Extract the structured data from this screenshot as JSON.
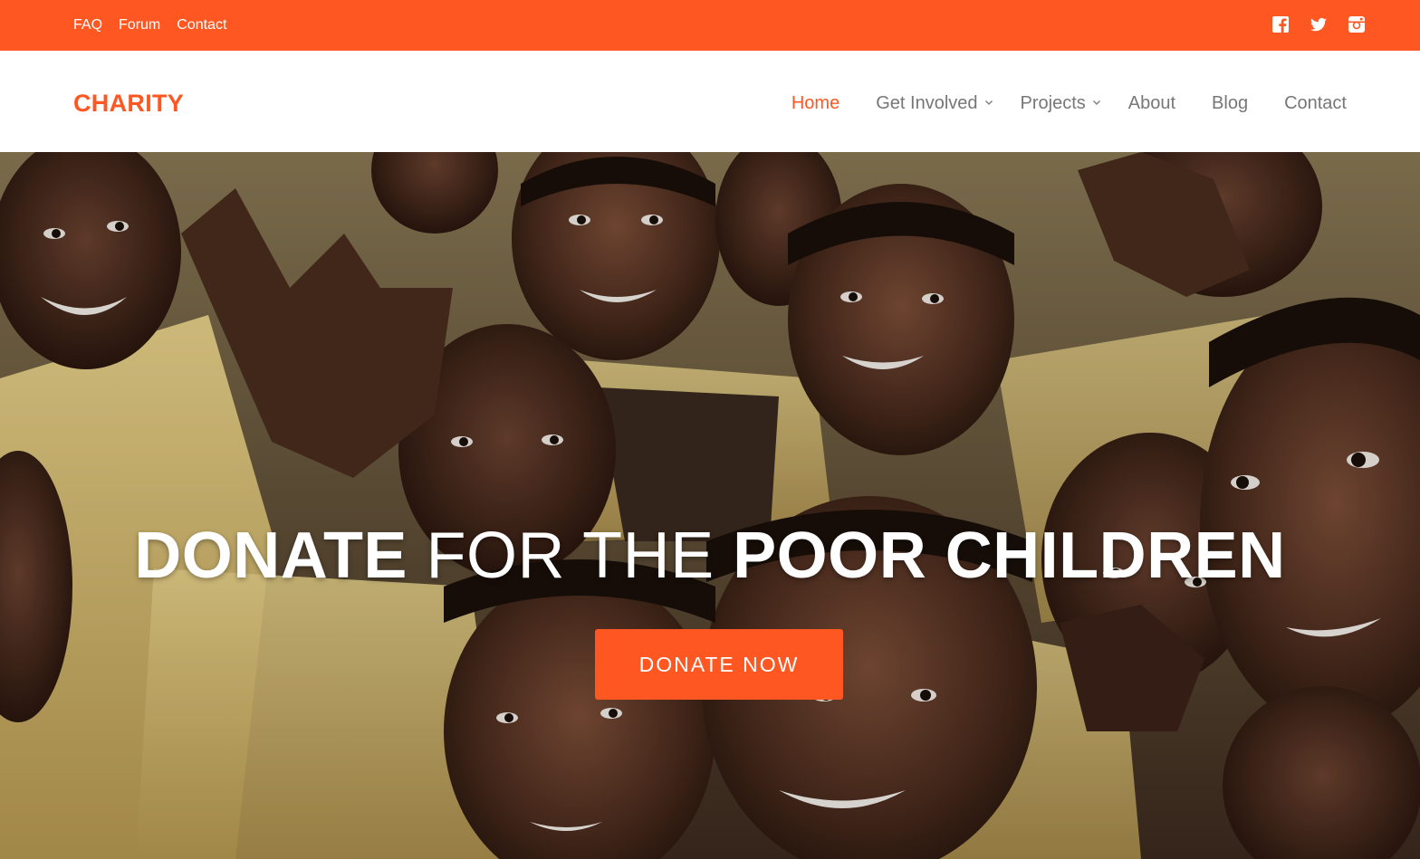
{
  "topbar": {
    "links": [
      "FAQ",
      "Forum",
      "Contact"
    ],
    "social_icons": [
      "facebook-icon",
      "twitter-icon",
      "instagram-icon"
    ],
    "color": "#ff5722"
  },
  "header": {
    "logo": "CHARITY",
    "nav": [
      {
        "label": "Home",
        "active": true,
        "dropdown": false
      },
      {
        "label": "Get Involved",
        "active": false,
        "dropdown": true
      },
      {
        "label": "Projects",
        "active": false,
        "dropdown": true
      },
      {
        "label": "About",
        "active": false,
        "dropdown": false
      },
      {
        "label": "Blog",
        "active": false,
        "dropdown": false
      },
      {
        "label": "Contact",
        "active": false,
        "dropdown": false
      }
    ]
  },
  "hero": {
    "title_part1": "DONATE",
    "title_part2": " FOR THE ",
    "title_part3": "POOR CHILDREN",
    "button_label": "DONATE NOW"
  },
  "colors": {
    "accent": "#ff5722",
    "nav_text": "#777777",
    "white": "#ffffff"
  }
}
